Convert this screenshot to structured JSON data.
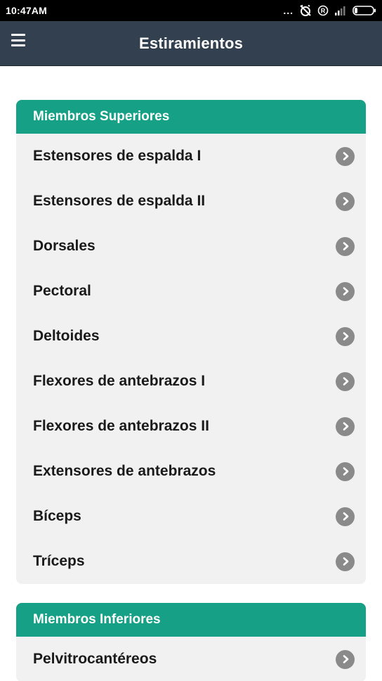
{
  "status_bar": {
    "time": "10:47AM",
    "dots": "...",
    "icons": [
      "alarm-off-icon",
      "registered-icon",
      "signal-icon",
      "battery-icon"
    ]
  },
  "app_bar": {
    "title": "Estiramientos",
    "menu_icon": "hamburger-menu-icon"
  },
  "sections": [
    {
      "title": "Miembros Superiores",
      "items": [
        {
          "label": "Estensores de espalda I"
        },
        {
          "label": "Estensores de espalda II"
        },
        {
          "label": "Dorsales"
        },
        {
          "label": "Pectoral"
        },
        {
          "label": "Deltoides"
        },
        {
          "label": "Flexores de antebrazos I"
        },
        {
          "label": "Flexores de antebrazos II"
        },
        {
          "label": "Extensores de antebrazos"
        },
        {
          "label": "Bíceps"
        },
        {
          "label": "Tríceps"
        }
      ]
    },
    {
      "title": "Miembros Inferiores",
      "items": [
        {
          "label": "Pelvitrocantéreos"
        }
      ]
    }
  ],
  "colors": {
    "app_bar": "#33404f",
    "section_header": "#16a085",
    "row_background": "#f1f1f1",
    "chevron": "#8a8a8a"
  }
}
